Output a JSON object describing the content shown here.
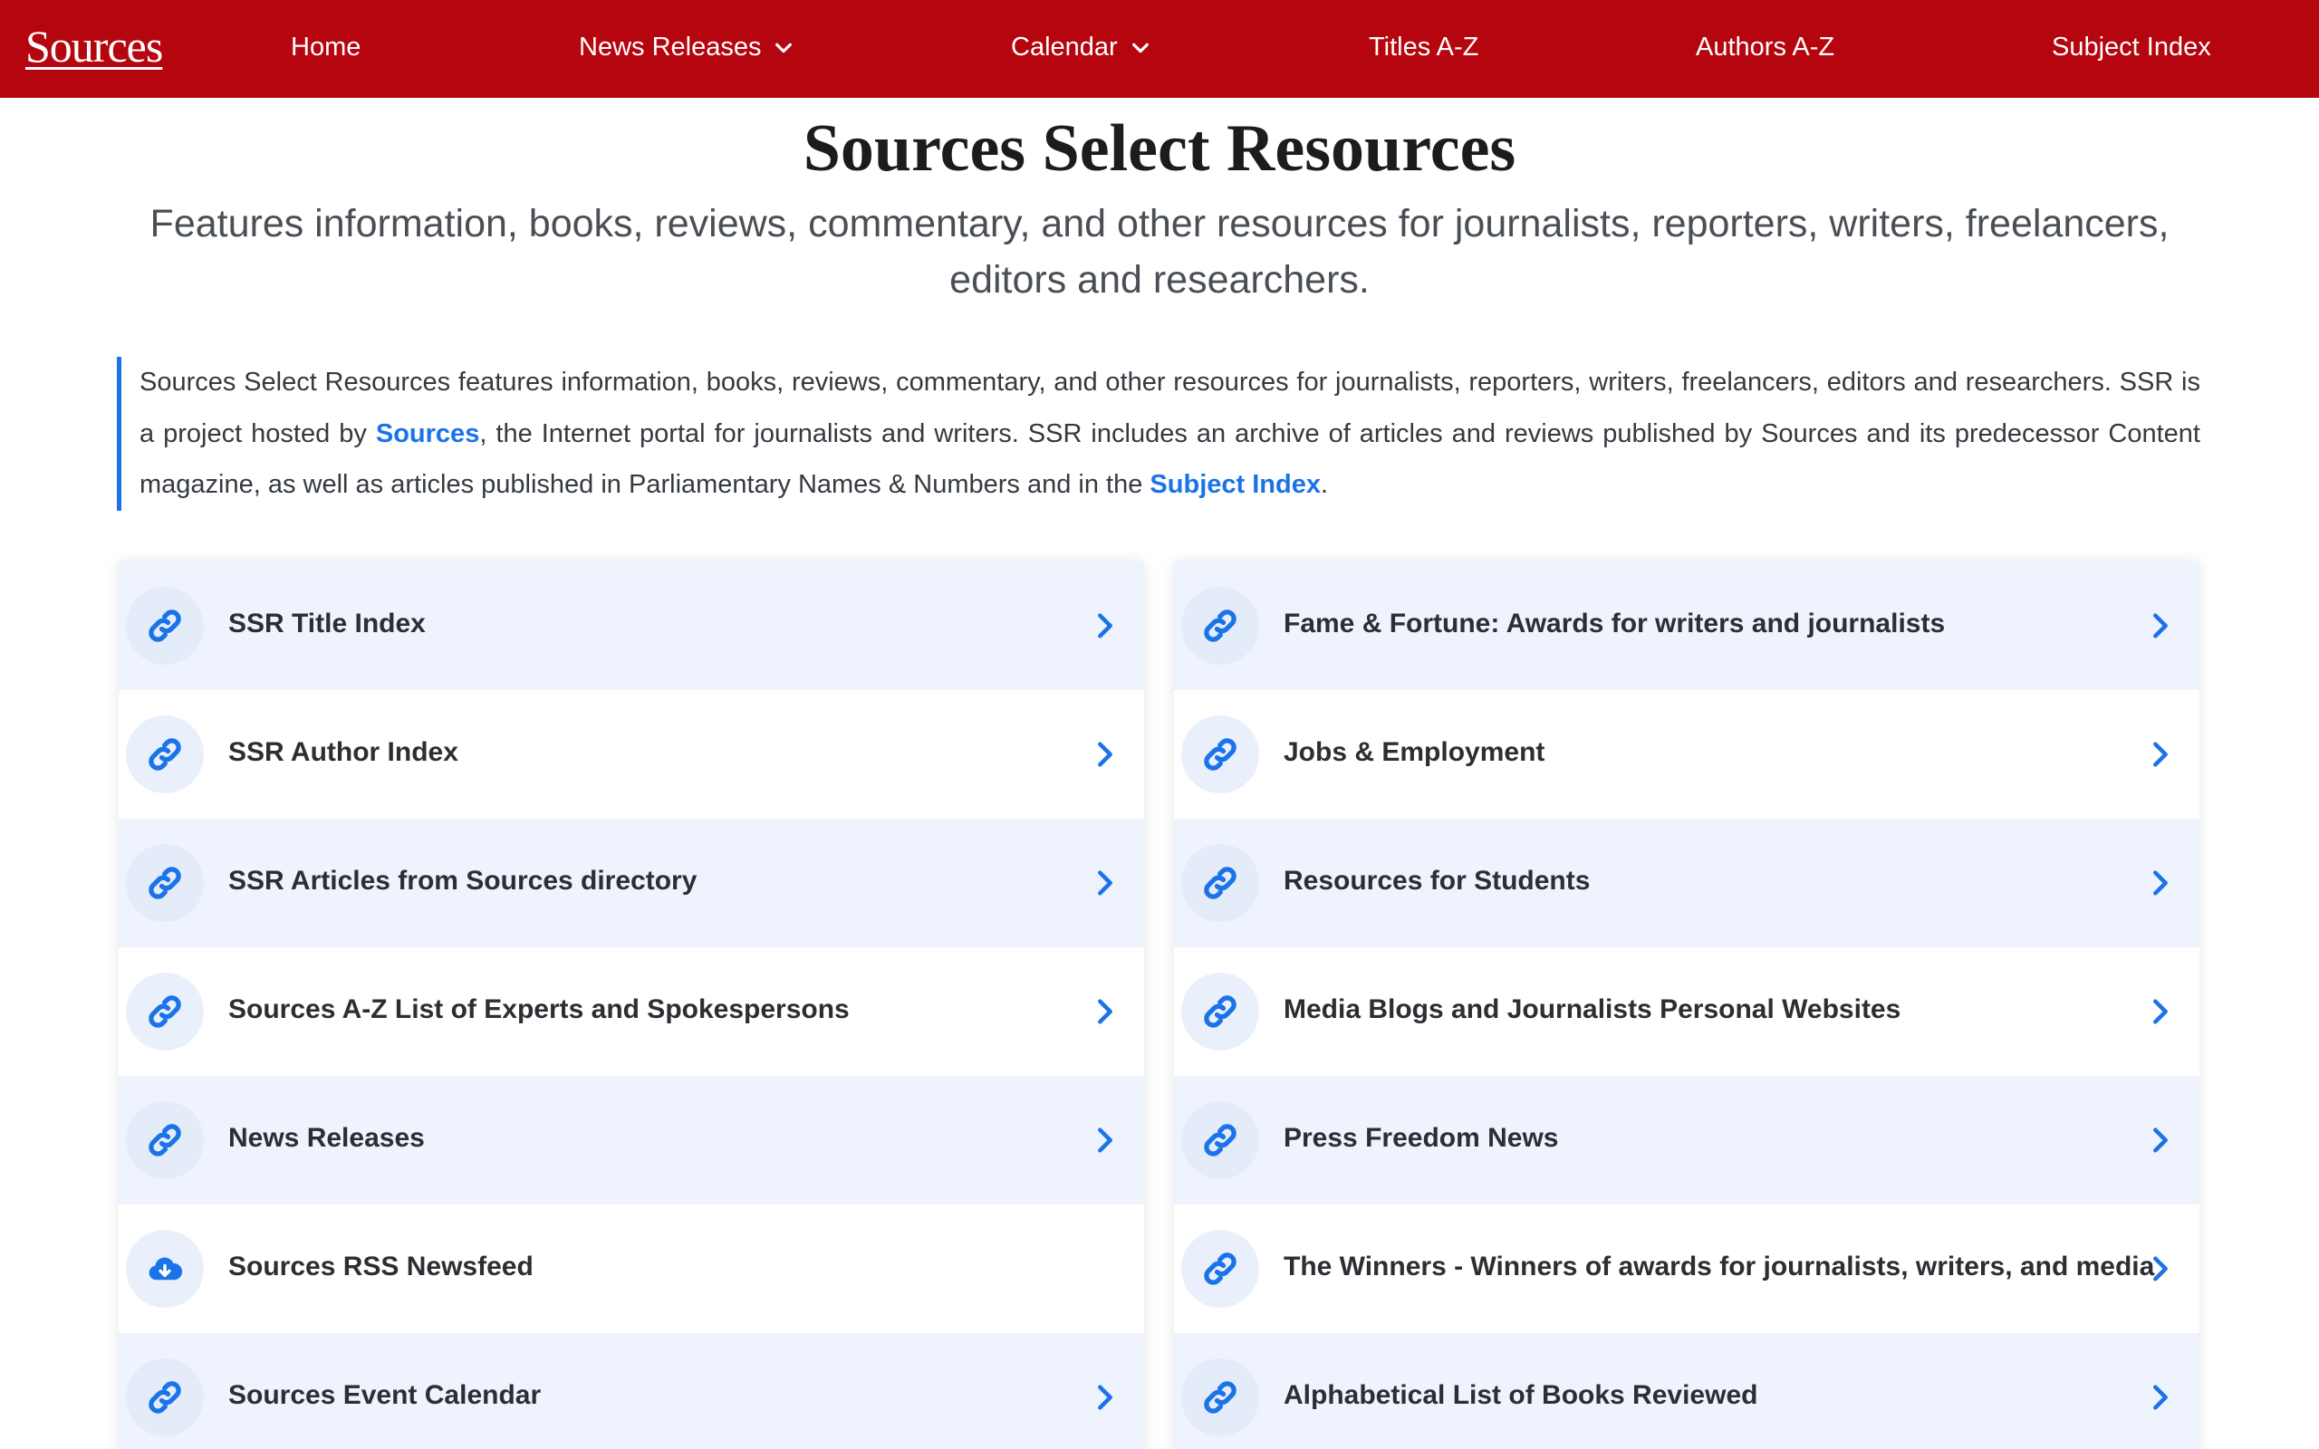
{
  "navbar": {
    "brand": "Sources",
    "items": [
      {
        "label": "Home",
        "dropdown": false
      },
      {
        "label": "News Releases",
        "dropdown": true
      },
      {
        "label": "Calendar",
        "dropdown": true
      },
      {
        "label": "Titles A-Z",
        "dropdown": false
      },
      {
        "label": "Authors A-Z",
        "dropdown": false
      },
      {
        "label": "Subject Index",
        "dropdown": false
      }
    ]
  },
  "hero": {
    "title": "Sources Select Resources",
    "subtitle": "Features information, books, reviews, commentary, and other resources for journalists, reporters, writers, freelancers, editors and researchers."
  },
  "intro": {
    "text_1": "Sources Select Resources features information, books, reviews, commentary, and other resources for journalists, reporters, writers, freelancers, editors and researchers. SSR is a project hosted by ",
    "link_1": "Sources",
    "text_2": ", the Internet portal for journalists and writers. SSR includes an archive of articles and reviews published by Sources and its predecessor Content maga­zine, as well as articles published in Parliamentary Names & Numbers and in the ",
    "link_2": "Subject Index",
    "text_3": "."
  },
  "left_list": [
    {
      "label": "SSR Title Index",
      "icon": "link-icon",
      "arrow": true
    },
    {
      "label": "SSR Author Index",
      "icon": "link-icon",
      "arrow": true
    },
    {
      "label": "SSR Articles from Sources directory",
      "icon": "link-icon",
      "arrow": true
    },
    {
      "label": "Sources A-Z List of Experts and Spokespersons",
      "icon": "link-icon",
      "arrow": true
    },
    {
      "label": "News Releases",
      "icon": "link-icon",
      "arrow": true
    },
    {
      "label": "Sources RSS Newsfeed",
      "icon": "cloud-download-icon",
      "arrow": false
    },
    {
      "label": "Sources Event Calendar",
      "icon": "link-icon",
      "arrow": true
    }
  ],
  "right_list": [
    {
      "label": "Fame & Fortune: Awards for writers and journalists",
      "icon": "link-icon",
      "arrow": true
    },
    {
      "label": "Jobs & Employment",
      "icon": "link-icon",
      "arrow": true
    },
    {
      "label": "Resources for Students",
      "icon": "link-icon",
      "arrow": true
    },
    {
      "label": "Media Blogs and Journalists Personal Websites",
      "icon": "link-icon",
      "arrow": true
    },
    {
      "label": "Press Freedom News",
      "icon": "link-icon",
      "arrow": true
    },
    {
      "label": "The Winners - Winners of awards for journalists, writers, and media",
      "icon": "link-icon",
      "arrow": true
    },
    {
      "label": "Alphabetical List of Books Reviewed",
      "icon": "link-icon",
      "arrow": true
    }
  ],
  "colors": {
    "navbar": "#b5050f",
    "accent": "#1a73e8",
    "row_shade": "#eef3fd"
  }
}
